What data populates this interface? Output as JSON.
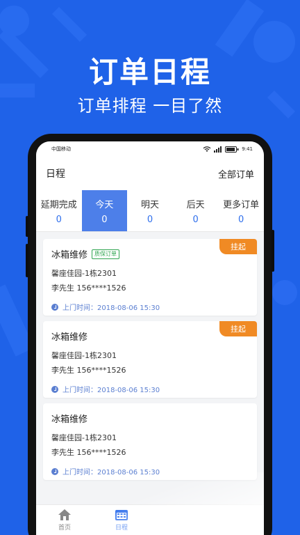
{
  "promo": {
    "title": "订单日程",
    "subtitle": "订单排程 一目了然"
  },
  "status_bar": {
    "carrier": "中国移动",
    "time": "9:41"
  },
  "header": {
    "title": "日程",
    "all_orders": "全部订单"
  },
  "tabs": [
    {
      "label": "延期完成",
      "count": "0",
      "active": false
    },
    {
      "label": "今天",
      "count": "0",
      "active": true
    },
    {
      "label": "明天",
      "count": "0",
      "active": false
    },
    {
      "label": "后天",
      "count": "0",
      "active": false
    },
    {
      "label": "更多订单",
      "count": "0",
      "active": false
    }
  ],
  "orders": [
    {
      "title": "冰箱维修",
      "tag": "质保订单",
      "badge": "挂起",
      "address": "馨座佳园-1栋2301",
      "person": "李先生  156****1526",
      "time": "上门时间：2018-08-06  15:30"
    },
    {
      "title": "冰箱维修",
      "badge": "挂起",
      "address": "馨座佳园-1栋2301",
      "person": "李先生  156****1526",
      "time": "上门时间：2018-08-06  15:30"
    },
    {
      "title": "冰箱维修",
      "address": "馨座佳园-1栋2301",
      "person": "李先生  156****1526",
      "time": "上门时间：2018-08-06  15:30"
    }
  ],
  "tabbar": [
    {
      "label": "首页",
      "icon": "home-icon",
      "active": false
    },
    {
      "label": "日程",
      "icon": "calendar-icon",
      "active": true
    }
  ],
  "colors": {
    "background": "#1f62e8",
    "active_tab": "#4d7fe9",
    "count_blue": "#2f6fec",
    "suspend_orange": "#f08a24",
    "tag_green": "#2ea44f"
  }
}
